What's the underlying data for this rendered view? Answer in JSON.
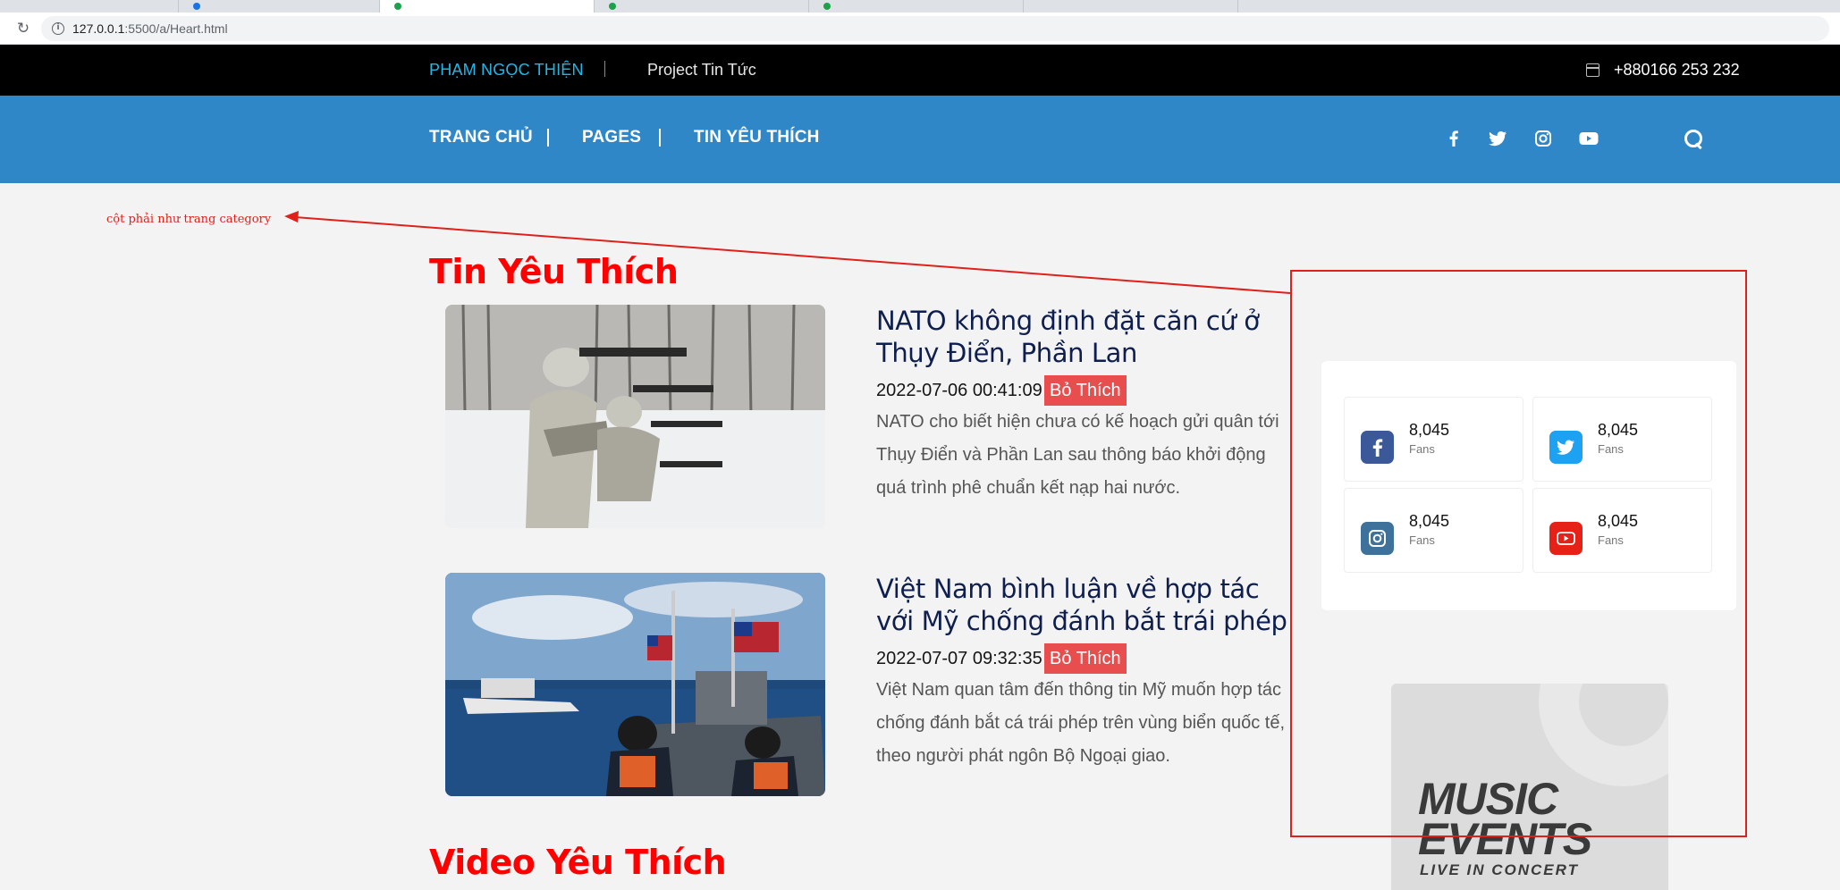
{
  "browser": {
    "url_host": "127.0.0.1",
    "url_path": ":5500/a/Heart.html"
  },
  "topbar": {
    "author": "PHẠM NGỌC THIỆN",
    "project": "Project Tin Tức",
    "phone": "+880166 253 232"
  },
  "nav": {
    "items": [
      "TRANG CHỦ",
      "PAGES",
      "TIN YÊU THÍCH"
    ],
    "social_icons": [
      "facebook-icon",
      "twitter-icon",
      "instagram-icon",
      "youtube-icon"
    ]
  },
  "annotation": {
    "text": "cột phải như trang category",
    "color": "#e0201a"
  },
  "favorites": {
    "title": "Tin Yêu Thích",
    "articles": [
      {
        "title": "NATO không định đặt căn cứ ở Thụy Điển, Phần Lan",
        "datetime": "2022-07-06 00:41:09",
        "button": "Bỏ Thích",
        "excerpt": "NATO cho biết hiện chưa có kế hoạch gửi quân tới Thụy Điển và Phần Lan sau thông báo khởi động quá trình phê chuẩn kết nạp hai nước."
      },
      {
        "title": "Việt Nam bình luận về hợp tác với Mỹ chống đánh bắt trái phép",
        "datetime": "2022-07-07 09:32:35",
        "button": "Bỏ Thích",
        "excerpt": "Việt Nam quan tâm đến thông tin Mỹ muốn hợp tác chống đánh bắt cá trái phép trên vùng biển quốc tế, theo người phát ngôn Bộ Ngoại giao."
      }
    ]
  },
  "video_section": {
    "title": "Video Yêu Thích"
  },
  "sidebar": {
    "social_stats": [
      {
        "network": "facebook",
        "icon": "facebook-icon",
        "count": "8,045",
        "label": "Fans",
        "color": "#3b5998"
      },
      {
        "network": "twitter",
        "icon": "twitter-icon",
        "count": "8,045",
        "label": "Fans",
        "color": "#1da1f2"
      },
      {
        "network": "instagram",
        "icon": "instagram-icon",
        "count": "8,045",
        "label": "Fans",
        "color": "#3f729b"
      },
      {
        "network": "youtube",
        "icon": "youtube-icon",
        "count": "8,045",
        "label": "Fans",
        "color": "#e62117"
      }
    ],
    "promo": {
      "line1": "MUSIC",
      "line2": "EVENTS",
      "line3": "LIVE IN CONCERT"
    }
  },
  "colors": {
    "topbar_bg": "#000000",
    "nav_bg": "#2f87c8",
    "author": "#1fb8e8",
    "section_title": "#ff0000",
    "unlike_button": "#e94e4e"
  }
}
